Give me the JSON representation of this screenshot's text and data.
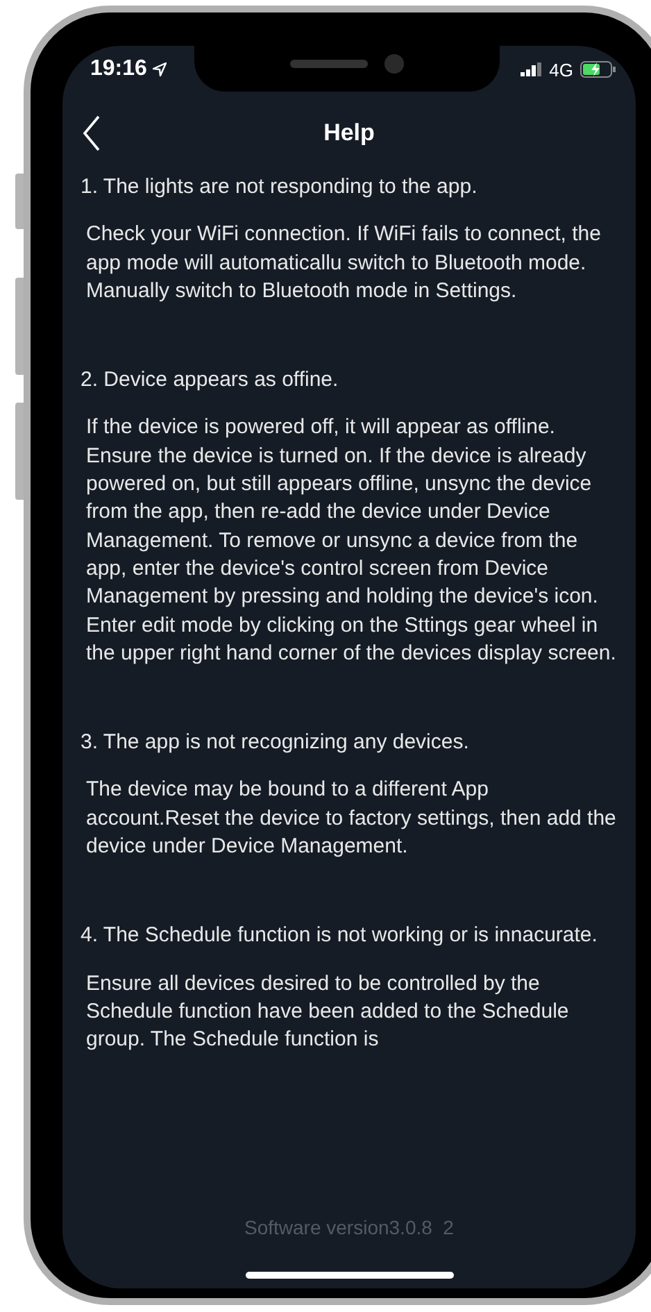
{
  "status_bar": {
    "time": "19:16",
    "network": "4G"
  },
  "nav": {
    "title": "Help"
  },
  "faq": [
    {
      "question": "1. The lights are not responding to the app.",
      "answer": "Check your WiFi connection. If WiFi fails to connect, the app mode will automaticallu switch to Bluetooth mode. Manually switch to Bluetooth mode in Settings."
    },
    {
      "question": "2. Device appears as offine.",
      "answer": "If the device is powered off, it will appear as offline. Ensure the device is turned on. If the device is already powered on, but still appears offline, unsync the device from the app, then re-add the device under Device Management. To remove or unsync a device from the app, enter the device's control screen from Device Management by pressing and holding the device's icon. Enter edit mode by clicking on the Sttings gear wheel in the upper right hand corner of the devices display screen."
    },
    {
      "question": "3. The app is not recognizing any devices.",
      "answer": "The device may be bound to a different App account.Reset the device to factory settings, then add the device under Device Management."
    },
    {
      "question": "4. The Schedule function is not working or is innacurate.",
      "answer": "Ensure all devices desired to be controlled by the Schedule function have been added to the Schedule group. The Schedule function is"
    }
  ],
  "footer": "Software version3.0.8  2"
}
